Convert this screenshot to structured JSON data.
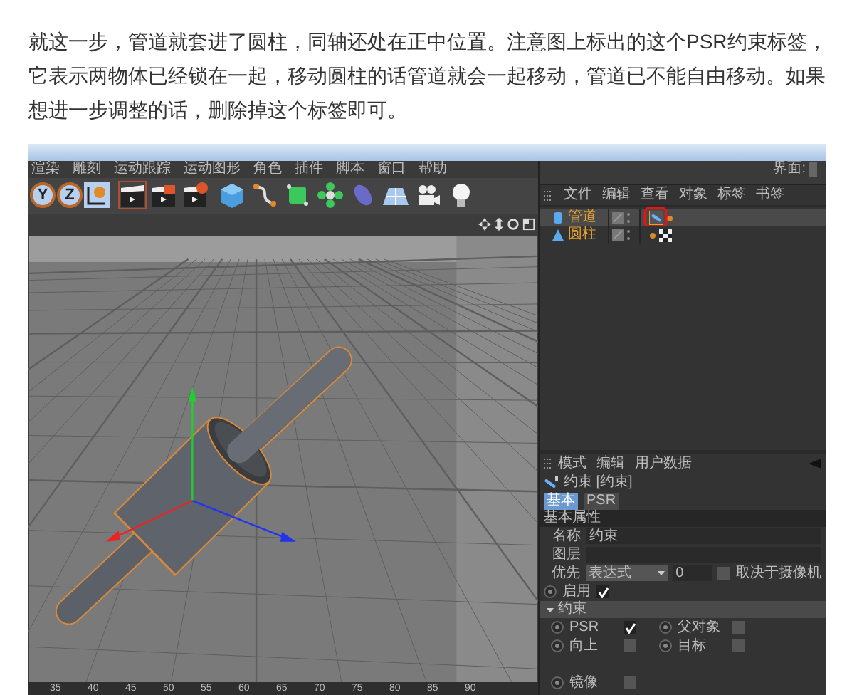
{
  "article": {
    "paragraph": "就这一步，管道就套进了圆柱，同轴还处在正中位置。注意图上标出的这个PSR约束标签，它表示两物体已经锁在一起，移动圆柱的话管道就会一起移动，管道已不能自由移动。如果想进一步调整的话，删除掉这个标签即可。"
  },
  "app": {
    "menu": [
      "渲染",
      "雕刻",
      "运动跟踪",
      "运动图形",
      "角色",
      "插件",
      "脚本",
      "窗口",
      "帮助"
    ],
    "axis_buttons": [
      "Y",
      "Z"
    ],
    "layout_label": "界面:",
    "viewport": {
      "ruler_ticks": [
        "35",
        "40",
        "45",
        "50",
        "55",
        "60",
        "65",
        "70",
        "75",
        "80",
        "85",
        "90"
      ]
    },
    "object_manager": {
      "menu": [
        "文件",
        "编辑",
        "查看",
        "对象",
        "标签",
        "书签"
      ],
      "objects": [
        {
          "name": "管道",
          "kind": "pipe",
          "selected": true
        },
        {
          "name": "圆柱",
          "kind": "cylinder",
          "selected": false
        }
      ]
    },
    "attribute_manager": {
      "menu": [
        "模式",
        "编辑",
        "用户数据"
      ],
      "title": "约束 [约束]",
      "tabs": [
        {
          "label": "基本",
          "selected": true
        },
        {
          "label": "PSR",
          "selected": false
        }
      ],
      "section": "基本属性",
      "name_label": "名称",
      "name_value": "约束",
      "layer_label": "图层",
      "priority_label": "优先",
      "priority_value": "表达式",
      "priority_number": "0",
      "camera_dependent": {
        "label": "取决于摄像机",
        "checked": false
      },
      "enabled": {
        "label": "启用",
        "checked": true
      },
      "constraints": {
        "title": "约束",
        "expanded": true,
        "rows": [
          [
            {
              "label": "PSR",
              "checked": true
            },
            {
              "label": "父对象",
              "checked": false
            }
          ],
          [
            {
              "label": "向上",
              "checked": false
            },
            {
              "label": "目标",
              "checked": false
            }
          ],
          [
            {
              "label": "镜像",
              "checked": false
            }
          ]
        ]
      }
    }
  }
}
